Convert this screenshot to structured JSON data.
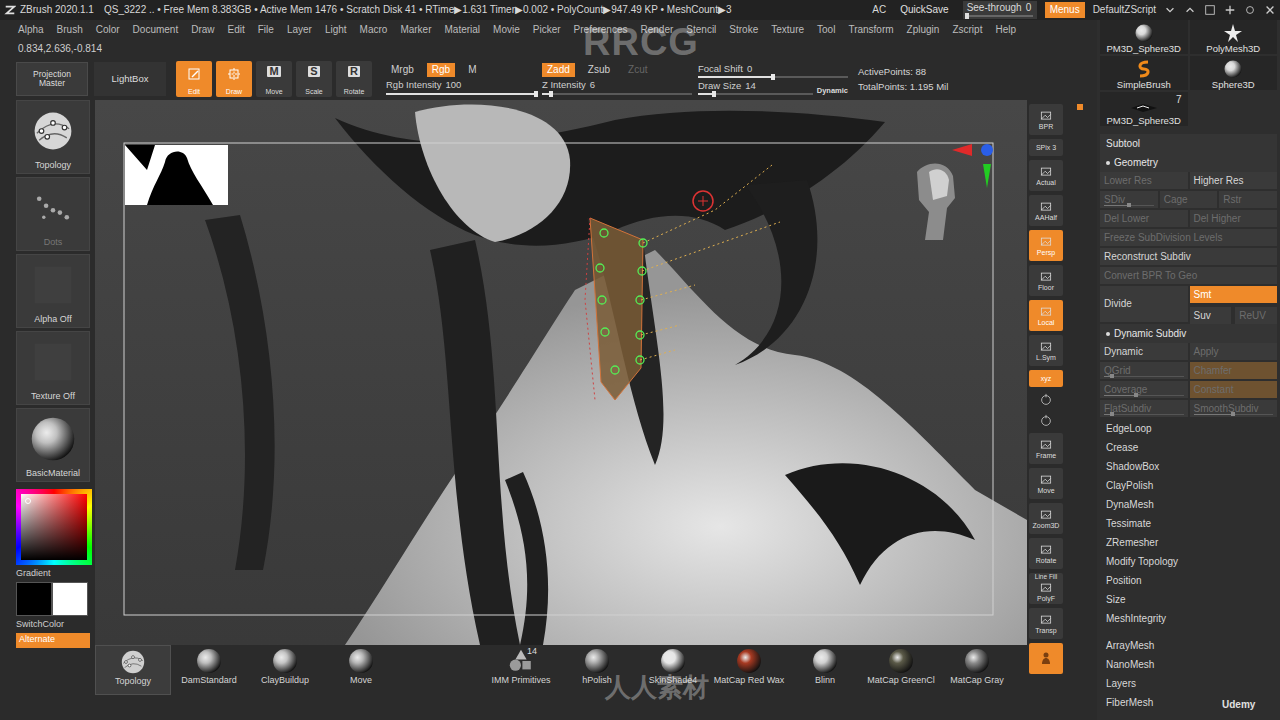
{
  "titlebar": {
    "app": "ZBrush 2020.1.1",
    "stats": "QS_3222  .. • Free Mem 8.383GB • Active Mem 1476 • Scratch Disk 41 • RTime▶1.631 Timer▶0.002 • PolyCount▶947.49 KP • MeshCount▶3",
    "ac": "AC",
    "quicksave": "QuickSave",
    "see_through": {
      "label": "See-through",
      "value": "0",
      "level": 0
    },
    "menus": {
      "label": "Menus",
      "on": true
    },
    "script": "DefaultZScript"
  },
  "menubar": [
    "Alpha",
    "Brush",
    "Color",
    "Document",
    "Draw",
    "Edit",
    "File",
    "Layer",
    "Light",
    "Macro",
    "Marker",
    "Material",
    "Movie",
    "Picker",
    "Preferences",
    "Render",
    "Stencil",
    "Stroke",
    "Texture",
    "Tool",
    "Transform",
    "Zplugin",
    "Zscript",
    "Help"
  ],
  "coords": "0.834,2.636,-0.814",
  "shelf": {
    "projection_master": "Projection Master",
    "lightbox": "LightBox",
    "modes": [
      {
        "label": "Edit",
        "selected": true
      },
      {
        "label": "Draw",
        "selected": true
      },
      {
        "label": "Move",
        "glyph": "M",
        "selected": false
      },
      {
        "label": "Scale",
        "glyph": "S",
        "selected": false
      },
      {
        "label": "Rotate",
        "glyph": "R",
        "selected": false
      }
    ],
    "color_modes": [
      {
        "label": "Mrgb",
        "selected": false
      },
      {
        "label": "Rgb",
        "selected": true
      },
      {
        "label": "M",
        "selected": false
      }
    ],
    "rgb_intensity": {
      "label": "Rgb Intensity",
      "value": "100",
      "level": 1
    },
    "z_modes": [
      {
        "label": "Zadd",
        "selected": true,
        "disabled": false
      },
      {
        "label": "Zsub",
        "selected": false,
        "disabled": false
      },
      {
        "label": "Zcut",
        "selected": false,
        "disabled": true
      }
    ],
    "z_intensity": {
      "label": "Z Intensity",
      "value": "6",
      "level": 0.06
    },
    "focal_shift": {
      "label": "Focal Shift",
      "value": "0",
      "level": 0.5
    },
    "draw_size": {
      "label": "Draw Size",
      "value": "14",
      "level": 0.14
    },
    "dynamic": "Dynamic",
    "active_points": "ActivePoints: 88",
    "total_points": "TotalPoints: 1.195 Mil"
  },
  "tray": {
    "items": [
      {
        "label": "Topology",
        "kind": "topology",
        "disabled": false
      },
      {
        "label": "Dots",
        "kind": "stroke",
        "disabled": true
      },
      {
        "label": "Alpha Off",
        "kind": "alpha",
        "disabled": false
      },
      {
        "label": "Texture Off",
        "kind": "texture",
        "disabled": false
      },
      {
        "label": "BasicMaterial",
        "kind": "material",
        "disabled": false
      }
    ],
    "gradient": "Gradient",
    "swatches": [
      {
        "color": "#000000"
      },
      {
        "color": "#ffffff"
      }
    ],
    "switch_color": "SwitchColor",
    "alternate": {
      "label": "Alternate",
      "on": true
    }
  },
  "view_toolbar": [
    {
      "label": "BPR",
      "kind": "btn",
      "selected": false
    },
    {
      "label": "SPix 3",
      "kind": "small",
      "selected": false
    },
    {
      "label": "Actual",
      "kind": "btn",
      "selected": false
    },
    {
      "label": "AAHalf",
      "kind": "btn",
      "selected": false
    },
    {
      "label": "Persp",
      "kind": "btn",
      "selected": true
    },
    {
      "label": "Floor",
      "kind": "btn",
      "selected": false
    },
    {
      "label": "Local",
      "kind": "btn",
      "selected": true
    },
    {
      "label": "L.Sym",
      "kind": "btn",
      "selected": false
    },
    {
      "label": "xyz",
      "kind": "small",
      "selected": true
    },
    {
      "kind": "icon",
      "selected": false
    },
    {
      "kind": "icon",
      "selected": false
    },
    {
      "label": "Frame",
      "kind": "btn",
      "selected": false
    },
    {
      "label": "Move",
      "kind": "btn",
      "selected": false
    },
    {
      "label": "Zoom3D",
      "kind": "btn",
      "selected": false
    },
    {
      "label": "Rotate",
      "kind": "btn",
      "selected": false
    },
    {
      "label": "PolyF",
      "sub": "Line Fill",
      "kind": "btn",
      "selected": false
    },
    {
      "label": "Transp",
      "kind": "btn",
      "selected": false
    },
    {
      "kind": "icon-big",
      "selected": true
    }
  ],
  "panel": {
    "tools": [
      {
        "label": "PM3D_Sphere3D",
        "kind": "sphere"
      },
      {
        "label": "PolyMesh3D",
        "kind": "star"
      },
      {
        "label": "SimpleBrush",
        "kind": "brush"
      },
      {
        "label": "Sphere3D",
        "kind": "sphere"
      },
      {
        "label": "PM3D_Sphere3D",
        "kind": "slim",
        "count": "7"
      }
    ],
    "subtool": "Subtool",
    "geometry": {
      "title": "Geometry",
      "rows": [
        {
          "kind": "row",
          "buttons": [
            {
              "label": "Lower Res",
              "kind": "button",
              "disabled": true,
              "selected": false
            },
            {
              "label": "Higher Res",
              "kind": "button",
              "disabled": false,
              "selected": false
            }
          ]
        },
        {
          "kind": "row",
          "buttons": [
            {
              "label": "SDiv",
              "kind": "slider",
              "disabled": true,
              "selected": false,
              "level": 0.5
            },
            {
              "label": "Cage",
              "kind": "button",
              "disabled": true,
              "selected": false
            },
            {
              "label": "Rstr",
              "kind": "button",
              "disabled": true,
              "selected": false
            }
          ]
        },
        {
          "kind": "row",
          "buttons": [
            {
              "label": "Del Lower",
              "kind": "button",
              "disabled": true,
              "selected": false
            },
            {
              "label": "Del Higher",
              "kind": "button",
              "disabled": true,
              "selected": false
            }
          ]
        },
        {
          "kind": "row",
          "buttons": [
            {
              "label": "Freeze SubDivision Levels",
              "kind": "button",
              "disabled": true,
              "selected": false
            }
          ]
        },
        {
          "kind": "row",
          "buttons": [
            {
              "label": "Reconstruct Subdiv",
              "kind": "button",
              "disabled": false,
              "selected": false
            }
          ]
        },
        {
          "kind": "row",
          "buttons": [
            {
              "label": "Convert BPR To Geo",
              "kind": "button",
              "disabled": true,
              "selected": false
            }
          ]
        },
        {
          "kind": "divide",
          "main": {
            "label": "Divide",
            "kind": "button",
            "disabled": false,
            "selected": false
          },
          "options": [
            {
              "label": "Smt",
              "kind": "button",
              "disabled": false,
              "selected": true
            },
            {
              "label": "Suv",
              "kind": "button",
              "disabled": false,
              "selected": false
            },
            {
              "label": "ReUV",
              "kind": "button",
              "disabled": true,
              "selected": false
            }
          ]
        }
      ]
    },
    "dynamic_subdiv": {
      "title": "Dynamic Subdiv",
      "rows": [
        {
          "kind": "row",
          "buttons": [
            {
              "label": "Dynamic",
              "kind": "button",
              "disabled": false,
              "selected": false
            },
            {
              "label": "Apply",
              "kind": "button",
              "disabled": true,
              "selected": false
            }
          ]
        },
        {
          "kind": "row",
          "buttons": [
            {
              "label": "QGrid",
              "kind": "slider",
              "disabled": true,
              "selected": false,
              "level": 0.1
            },
            {
              "label": "Chamfer",
              "kind": "toggle",
              "disabled": true,
              "selected": true
            }
          ]
        },
        {
          "kind": "row",
          "buttons": [
            {
              "label": "Coverage",
              "kind": "slider",
              "disabled": true,
              "selected": false,
              "level": 0.4
            },
            {
              "label": "Constant",
              "kind": "toggle",
              "disabled": true,
              "selected": true
            }
          ]
        },
        {
          "kind": "row",
          "buttons": [
            {
              "label": "FlatSubdiv",
              "kind": "slider",
              "disabled": true,
              "selected": false,
              "level": 0.1
            },
            {
              "label": "SmoothSubdiv",
              "kind": "slider",
              "disabled": true,
              "selected": false,
              "level": 0.5
            }
          ]
        }
      ]
    },
    "subpalettes": [
      "EdgeLoop",
      "Crease",
      "ShadowBox",
      "ClayPolish",
      "DynaMesh",
      "Tessimate",
      "ZRemesher",
      "Modify Topology",
      "Position",
      "Size",
      "MeshIntegrity"
    ],
    "palettes": [
      "ArrayMesh",
      "NanoMesh",
      "Layers",
      "FiberMesh"
    ]
  },
  "bottom_shelf": [
    {
      "label": "Topology",
      "kind": "topology",
      "color": "#cfcfcf",
      "selected": true
    },
    {
      "label": "DamStandard",
      "kind": "brush",
      "color": "#bdbdbd",
      "selected": false
    },
    {
      "label": "ClayBuildup",
      "kind": "brush",
      "color": "#c4c4c4",
      "selected": false
    },
    {
      "label": "Move",
      "kind": "brush",
      "color": "#b5b5b5",
      "selected": false
    },
    {
      "label": "IMM Primitives",
      "kind": "imm",
      "color": "#9a9a9a",
      "count": "14",
      "selected": false
    },
    {
      "label": "hPolish",
      "kind": "material",
      "color": "#a8a8a8",
      "selected": false
    },
    {
      "label": "SkinShade4",
      "kind": "material",
      "color": "#e6e6e6",
      "selected": false
    },
    {
      "label": "MatCap Red Wax",
      "kind": "material",
      "color": "#a83a22",
      "selected": false
    },
    {
      "label": "Blinn",
      "kind": "material",
      "color": "#d0d0d0",
      "selected": false
    },
    {
      "label": "MatCap GreenCl",
      "kind": "material",
      "color": "#5b5a48",
      "selected": false
    },
    {
      "label": "MatCap Gray",
      "kind": "material",
      "color": "#8c8c8c",
      "selected": false
    }
  ],
  "watermarks": [
    "RRCG",
    "人人素材",
    "Udemy"
  ]
}
